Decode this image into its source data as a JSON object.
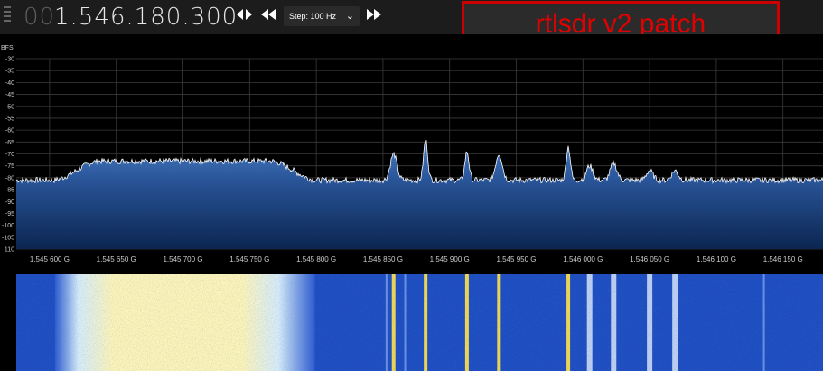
{
  "toolbar": {
    "frequency_prefix": "00",
    "frequency_main": "1.546.180.300",
    "play_icon": "play-pause-icon",
    "rewind_icon": "rewind-icon",
    "step_label": "Step: 100 Hz",
    "forward_icon": "fast-forward-icon"
  },
  "banner": {
    "text": "rtlsdr v2 patch",
    "color": "#e30000"
  },
  "chart_data": {
    "type": "line",
    "ylabel": "BFS",
    "y_ticks": [
      "-30",
      "-35",
      "-40",
      "-45",
      "-50",
      "-55",
      "-60",
      "-65",
      "-70",
      "-75",
      "-80",
      "-85",
      "-90",
      "-95",
      "-100",
      "-105",
      "110"
    ],
    "ylim": [
      -110,
      -30
    ],
    "x_ticks": [
      "1.545 600 G",
      "1.545 650 G",
      "1.545 700 G",
      "1.545 750 G",
      "1.545 800 G",
      "1.545 850 G",
      "1.545 900 G",
      "1.545 950 G",
      "1.546 000 G",
      "1.546 050 G",
      "1.546 100 G",
      "1.546 150 G"
    ],
    "xlim": [
      1545.575,
      1546.18
    ],
    "x_unit": "MHz",
    "noise_floor": -81,
    "wideband_signal": {
      "start": 1545.62,
      "end": 1545.783,
      "level": -73
    },
    "peaks": [
      {
        "x": 1545.858,
        "level": -70
      },
      {
        "x": 1545.882,
        "level": -64
      },
      {
        "x": 1545.913,
        "level": -69
      },
      {
        "x": 1545.937,
        "level": -70
      },
      {
        "x": 1545.989,
        "level": -67
      },
      {
        "x": 1546.005,
        "level": -75
      },
      {
        "x": 1546.023,
        "level": -74
      },
      {
        "x": 1546.05,
        "level": -77
      },
      {
        "x": 1546.069,
        "level": -77
      }
    ],
    "grid": true,
    "colors": {
      "fill_top": "#3b6bb0",
      "fill_bottom": "#0d2a5a",
      "trace": "#ffffff",
      "waterfall_bg": "#1b48b8",
      "waterfall_hot": "#ffe66a"
    }
  }
}
